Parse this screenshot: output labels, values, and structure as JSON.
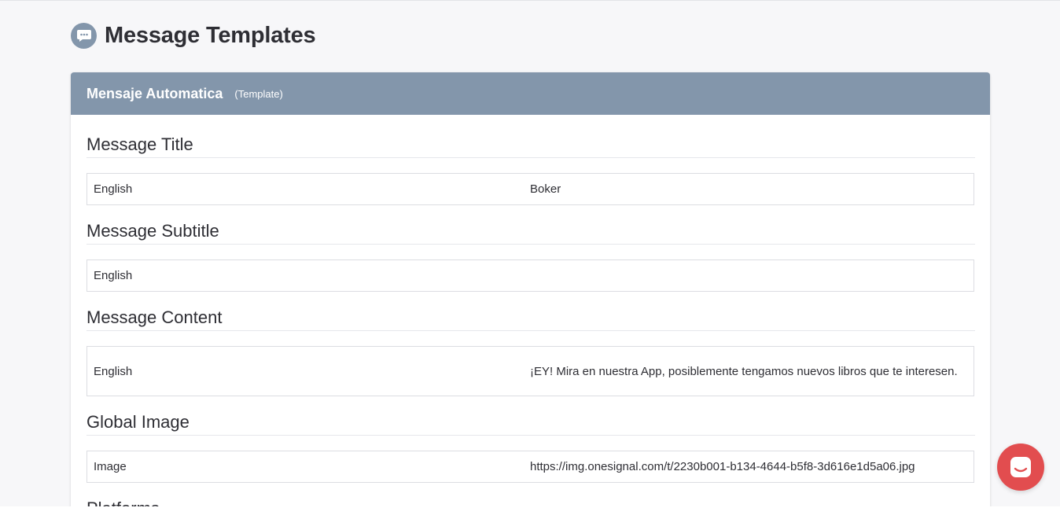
{
  "page": {
    "title": "Message Templates",
    "icon": "chat-bubble-icon"
  },
  "card": {
    "title": "Mensaje Automatica",
    "subtitle": "(Template)",
    "header_color": "#8396ab"
  },
  "sections": [
    {
      "title": "Message Title",
      "rows": [
        {
          "key": "English",
          "value": "Boker"
        }
      ]
    },
    {
      "title": "Message Subtitle",
      "rows": [
        {
          "key": "English",
          "value": ""
        }
      ]
    },
    {
      "title": "Message Content",
      "rows": [
        {
          "key": "English",
          "value": "¡EY! Mira en nuestra App, posiblemente tengamos nuevos libros que te interesen."
        }
      ]
    },
    {
      "title": "Global Image",
      "rows": [
        {
          "key": "Image",
          "value": "https://img.onesignal.com/t/2230b001-b134-4644-b5f8-3d616e1d5a06.jpg"
        }
      ]
    },
    {
      "title": "Platforms",
      "rows": []
    }
  ],
  "chat_widget": {
    "icon": "chat-launcher-icon",
    "color": "#e24d4f"
  }
}
